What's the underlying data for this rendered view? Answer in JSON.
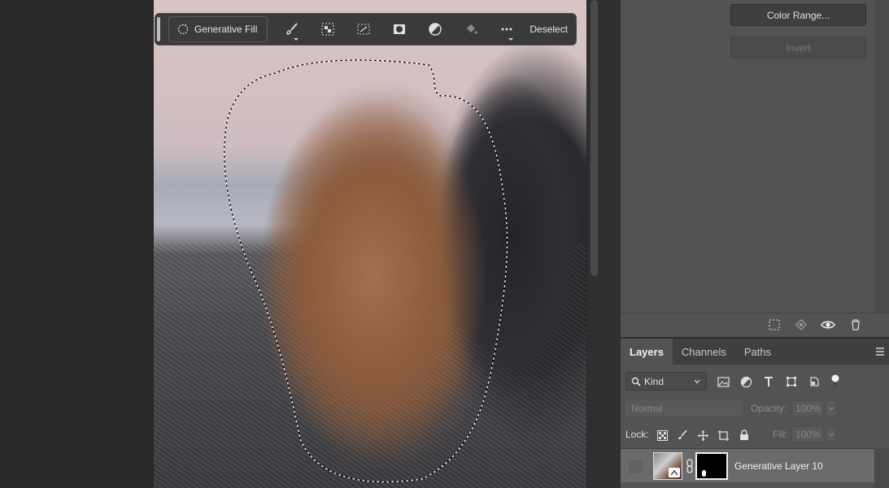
{
  "taskbar": {
    "generative_fill_label": "Generative Fill",
    "deselect_label": "Deselect"
  },
  "select_panel": {
    "color_range_label": "Color Range...",
    "invert_label": "Invert"
  },
  "layers_panel": {
    "tabs": [
      "Layers",
      "Channels",
      "Paths"
    ],
    "active_tab": "Layers",
    "filter_kind": "Kind",
    "blend_mode": "Normal",
    "opacity_label": "Opacity:",
    "opacity_value": "100%",
    "lock_label": "Lock:",
    "fill_label": "Fill:",
    "fill_value": "100%",
    "layer_name": "Generative Layer 10"
  }
}
